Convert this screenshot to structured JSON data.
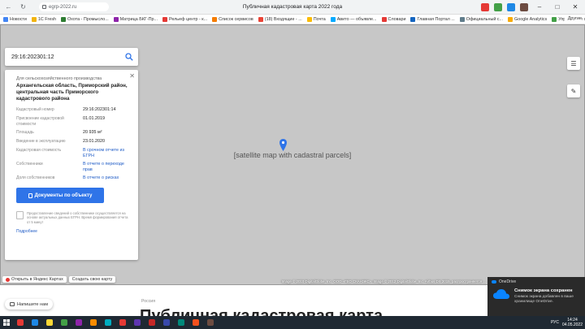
{
  "browser": {
    "url": "egrp-2022.ru",
    "tab_title": "Публичная кадастровая карта 2022 года",
    "bookmarks": [
      {
        "label": "Новости",
        "color": "#4285f4"
      },
      {
        "label": "1С Fresh",
        "color": "#f2b40d"
      },
      {
        "label": "Охота - Промысло...",
        "color": "#2e7d32"
      },
      {
        "label": "Матрица БКГ-Пр...",
        "color": "#8e24aa"
      },
      {
        "label": "Рельеф центр - к...",
        "color": "#e53935"
      },
      {
        "label": "Список сервисов",
        "color": "#f57c00"
      },
      {
        "label": "(18) Входящие - ...",
        "color": "#ea4335"
      },
      {
        "label": "Почта",
        "color": "#fbbc04"
      },
      {
        "label": "Авито — объявле...",
        "color": "#00aaff"
      },
      {
        "label": "Словари",
        "color": "#e53935"
      },
      {
        "label": "Главная Портал ...",
        "color": "#1565c0"
      },
      {
        "label": "Официальный с...",
        "color": "#607d8b"
      },
      {
        "label": "Google Analytics",
        "color": "#f9ab00"
      },
      {
        "label": "Управление сайт...",
        "color": "#43a047"
      }
    ],
    "other_bookmarks": "Другие"
  },
  "search": {
    "value": "29:16:202301:12"
  },
  "panel": {
    "category": "Для сельскохозяйственного производства",
    "address": "Архангельская область, Приморский район, центральная часть Приморского кадастрового района",
    "properties": [
      {
        "key": "Кадастровый номер",
        "value": "29:16:202301:14",
        "link": false
      },
      {
        "key": "Присвоение кадастровой стоимости",
        "value": "01.01.2019",
        "link": false
      },
      {
        "key": "Площадь",
        "value": "20 935 м²",
        "link": false
      },
      {
        "key": "Введение в эксплуатацию",
        "value": "23.01.2020",
        "link": false
      },
      {
        "key": "Кадастровая стоимость",
        "value": "В срочном отчете из ЕГРН",
        "link": true
      },
      {
        "key": "Собственники",
        "value": "В отчете о переходе прав",
        "link": true
      },
      {
        "key": "Доля собственников",
        "value": "В отчете о рисках",
        "link": true
      }
    ],
    "doc_button": "Документы по объекту",
    "note": "Предоставление сведений о собственнике осуществляется на основе актуальных данных ЕГРН. Время формирования отчета от 5 минут",
    "note_link": "Подробнее"
  },
  "map": {
    "attribution": "Image © 2010 DigitalGlobe, Inc. ООО «ГЕО СКАНЭКС», Image © 2012 DigitalGlobe, Inc. Airbus DS 2015, распространяется ...",
    "open_yandex": "Открыть в Яндекс Картах",
    "create_own": "Создать свою карту"
  },
  "lower": {
    "region": "Россия",
    "title": "Публичная кадастровая карта",
    "chat_button": "Напишите нам"
  },
  "toast": {
    "app": "OneDrive",
    "title": "Снимок экрана сохранен",
    "text": "Снимок экрана добавлен в ваше хранилище OneDrive."
  },
  "taskbar": {
    "time": "14:24",
    "date": "04.05.2022",
    "lang": "РУС",
    "apps": [
      "#e53935",
      "#1e88e5",
      "#fdd835",
      "#43a047",
      "#8e24aa",
      "#fb8c00",
      "#00acc1",
      "#e53935",
      "#5e35b1",
      "#c62828",
      "#3949ab",
      "#00897b",
      "#f4511e",
      "#6d4c41"
    ]
  }
}
